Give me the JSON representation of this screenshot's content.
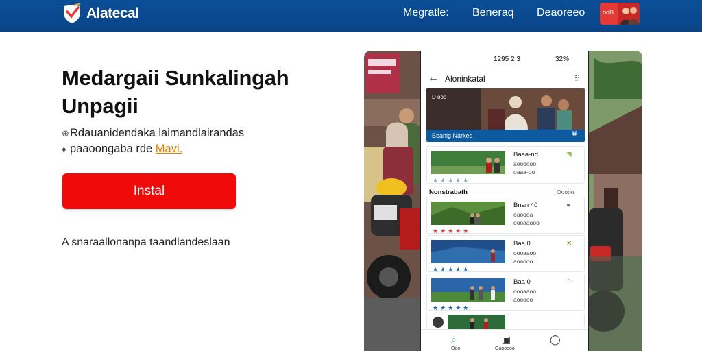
{
  "header": {
    "brand": "Alatecal",
    "nav": [
      "Megratle:",
      "Beneraq",
      "Deaoreeo"
    ],
    "badge_text": "ooB"
  },
  "hero": {
    "title": "Medargaii Sunkalingah Unpagii",
    "subtitle_line1": "Rdauanidendaka laimandlairandas",
    "subtitle_line2_prefix": "paaoongaba rde",
    "subtitle_link": "Mavi.",
    "install_label": "Instal",
    "footer": "A snaraallonanpa taandlandeslaan"
  },
  "phone": {
    "status_time": "1295 2 3",
    "status_right": "32%",
    "app_title": "Aloninkatal",
    "banner_caption": "Beanig Narked",
    "banner_overlay": "D ooo",
    "featured": {
      "title": "Baaa-nd",
      "lines": [
        "aoooooo",
        "oaaa-oo"
      ],
      "stars": "★★★★★"
    },
    "section_title": "Nonstrabath",
    "section_more": "Ooooo",
    "list": [
      {
        "title": "Bnan 40",
        "lines": [
          "oaoooa",
          "oooaaooo"
        ],
        "stars": "★★★★★",
        "star_color": "#e53935"
      },
      {
        "title": "Baa 0",
        "lines": [
          "oooaaoo",
          "aoaooo"
        ],
        "stars": "★★★★★",
        "star_color": "#1565c0"
      },
      {
        "title": "Baa 0",
        "lines": [
          "oooaaoo",
          "aooooo"
        ],
        "stars": "★★★★★",
        "star_color": "#1565c0"
      }
    ],
    "bottom_nav": [
      {
        "icon": "⌕",
        "label": "Ooo"
      },
      {
        "icon": "▣",
        "label": "Oaooooo"
      },
      {
        "icon": "◯",
        "label": ""
      }
    ]
  },
  "colors": {
    "header_bg": "#0b4f97",
    "install_bg": "#f00a0a",
    "link": "#e67e00"
  }
}
